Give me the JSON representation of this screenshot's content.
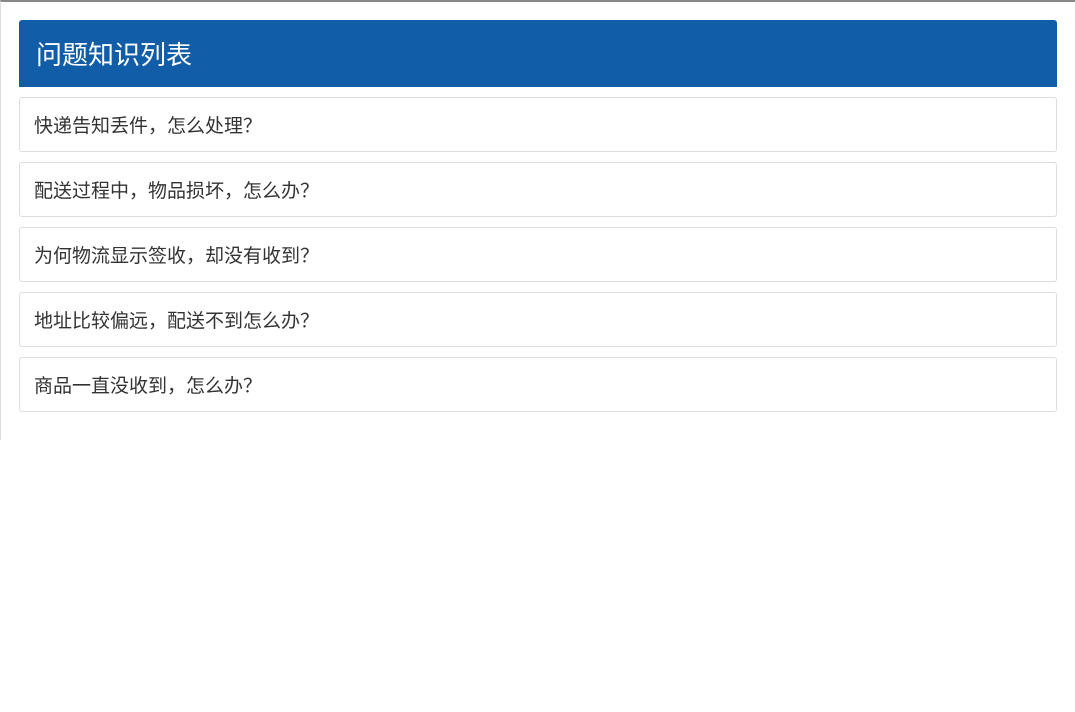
{
  "header": {
    "title": "问题知识列表"
  },
  "faq": {
    "items": [
      {
        "question": "快递告知丢件，怎么处理？"
      },
      {
        "question": "配送过程中，物品损坏，怎么办？"
      },
      {
        "question": "为何物流显示签收，却没有收到？"
      },
      {
        "question": "地址比较偏远，配送不到怎么办？"
      },
      {
        "question": "商品一直没收到，怎么办？"
      }
    ]
  }
}
